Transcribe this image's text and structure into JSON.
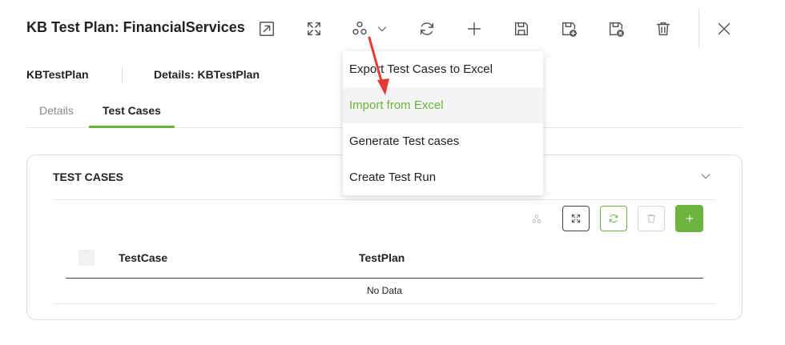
{
  "header": {
    "title": "KB Test Plan: FinancialServices"
  },
  "toolbar": {
    "icons": [
      "open-external-icon",
      "expand-icon",
      "settings-cluster-icon",
      "chevron-down-icon",
      "refresh-icon",
      "plus-icon",
      "save-icon",
      "save-add-icon",
      "save-close-icon",
      "trash-icon",
      "close-icon"
    ]
  },
  "info": {
    "name": "KBTestPlan",
    "details": "Details: KBTestPlan"
  },
  "tabs": [
    {
      "label": "Details",
      "active": false
    },
    {
      "label": "Test Cases",
      "active": true
    }
  ],
  "card": {
    "title": "TEST CASES",
    "columns": [
      "TestCase",
      "TestPlan"
    ],
    "empty_text": "No Data"
  },
  "dropdown": {
    "items": [
      {
        "label": "Export Test Cases to Excel"
      },
      {
        "label": "Import from Excel",
        "highlighted": true
      },
      {
        "label": "Generate Test cases"
      },
      {
        "label": "Create Test Run"
      }
    ]
  },
  "colors": {
    "accent": "#6db33f",
    "annotation_arrow": "#e53935"
  }
}
